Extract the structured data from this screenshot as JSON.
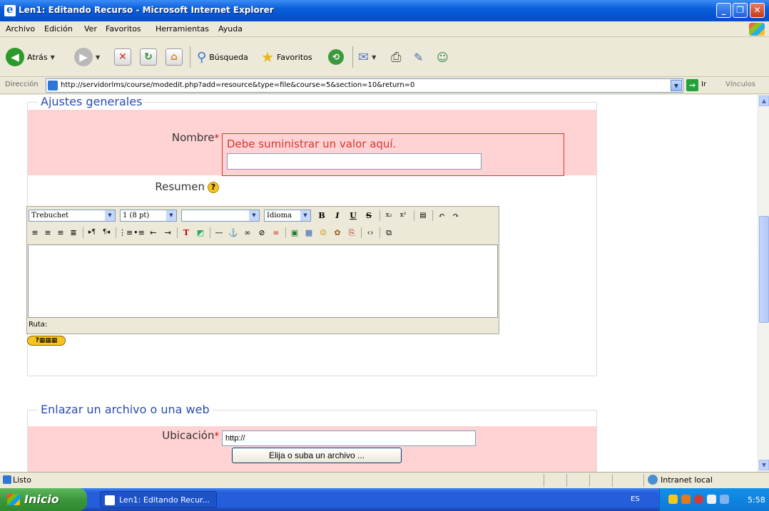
{
  "window": {
    "title": "Len1: Editando Recurso - Microsoft Internet Explorer"
  },
  "menu": [
    "Archivo",
    "Edición",
    "Ver",
    "Favoritos",
    "Herramientas",
    "Ayuda"
  ],
  "toolbar": {
    "back": "Atrás",
    "search": "Búsqueda",
    "favorites": "Favoritos"
  },
  "address": {
    "label": "Dirección",
    "url": "http://servidorlms/course/modedit.php?add=resource&type=file&course=5&section=10&return=0",
    "go": "Ir",
    "links": "Vínculos"
  },
  "general": {
    "legend": "Ajustes generales",
    "name_label": "Nombre",
    "required_mark": "*",
    "name_error": "Debe suministrar un valor aquí.",
    "name_value": "",
    "summary_label": "Resumen",
    "help_glyph": "?"
  },
  "editor": {
    "font": "Trebuchet",
    "size": "1 (8 pt)",
    "format": "",
    "language": "Idioma",
    "path_label": "Ruta:"
  },
  "link_section": {
    "legend": "Enlazar un archivo o una web",
    "location_label": "Ubicación",
    "location_value": "http://",
    "choose_button": "Elija o suba un archivo ..."
  },
  "status": {
    "text": "Listo",
    "zone": "Intranet local"
  },
  "taskbar": {
    "start": "Inicio",
    "task": "Len1: Editando Recur...",
    "lang": "ES",
    "clock": "5:58"
  }
}
